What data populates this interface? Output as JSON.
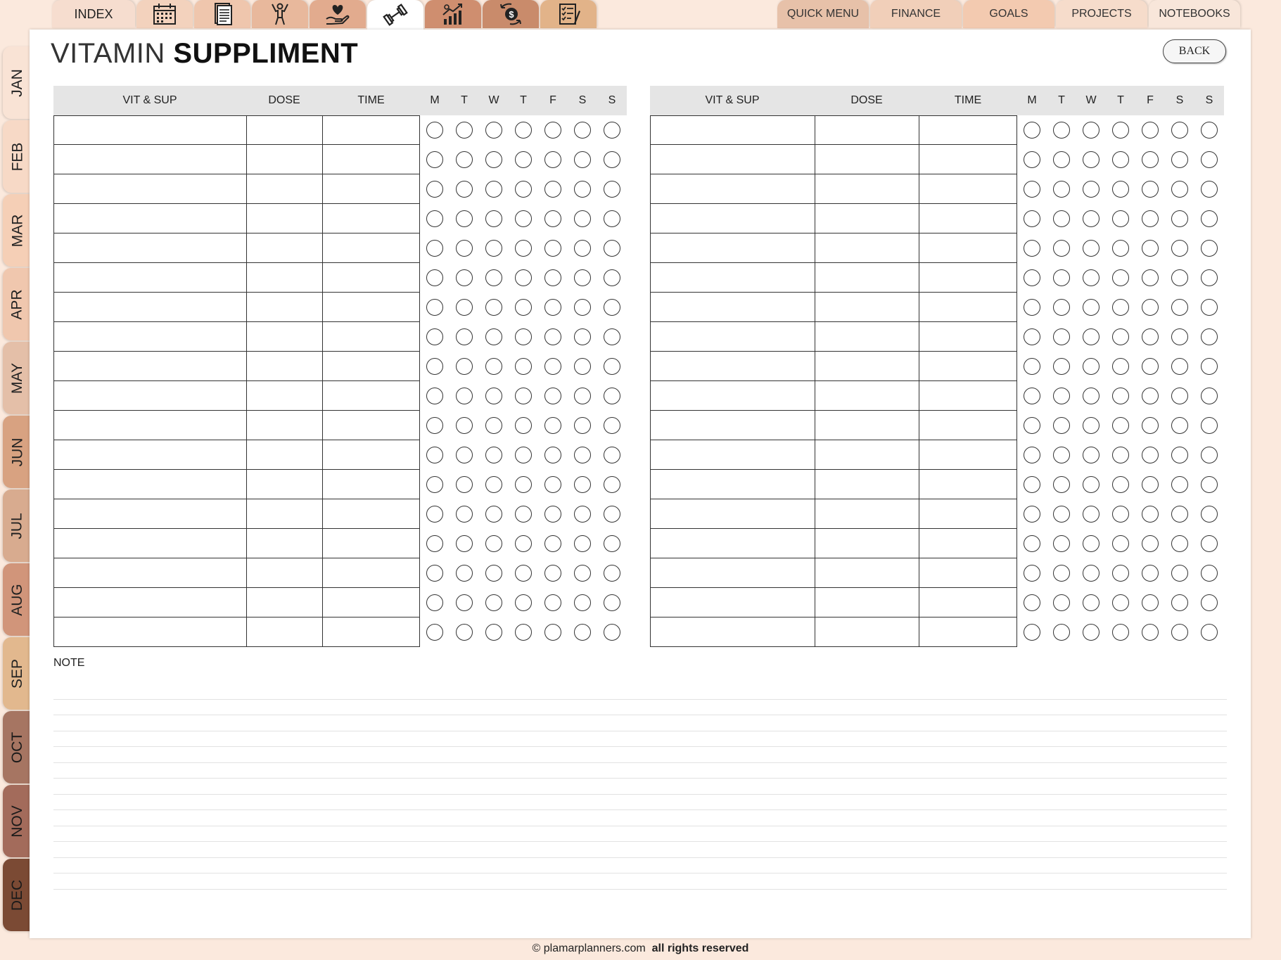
{
  "top_nav": {
    "index_label": "INDEX",
    "icon_tabs": [
      {
        "icon": "calendar-icon",
        "color": "#f3d2bd"
      },
      {
        "icon": "document-icon",
        "color": "#efc6ad"
      },
      {
        "icon": "fitness-person-icon",
        "color": "#e8b89c"
      },
      {
        "icon": "heart-hand-icon",
        "color": "#e2ab8e"
      },
      {
        "icon": "dumbbell-icon",
        "color": "#ffffff",
        "active": true
      },
      {
        "icon": "growth-chart-icon",
        "color": "#cf8e6f"
      },
      {
        "icon": "money-exchange-icon",
        "color": "#c98b6b"
      },
      {
        "icon": "checklist-icon",
        "color": "#e2b389"
      }
    ],
    "index_color": "#f6ddcf"
  },
  "right_nav": [
    {
      "label": "QUICK MENU",
      "color": "#e7c1a9"
    },
    {
      "label": "FINANCE",
      "color": "#f1cfb9"
    },
    {
      "label": "GOALS",
      "color": "#f3cab0"
    },
    {
      "label": "PROJECTS",
      "color": "#f6dccb"
    },
    {
      "label": "NOTEBOOKS",
      "color": "#f8e6da"
    }
  ],
  "months": [
    {
      "label": "JAN",
      "color": "#f9e3d5"
    },
    {
      "label": "FEB",
      "color": "#f7d9c6"
    },
    {
      "label": "MAR",
      "color": "#f5cfb6"
    },
    {
      "label": "APR",
      "color": "#f0c7ae"
    },
    {
      "label": "MAY",
      "color": "#e4bfa8"
    },
    {
      "label": "JUN",
      "color": "#d8a281"
    },
    {
      "label": "JUL",
      "color": "#d8ab8f"
    },
    {
      "label": "AUG",
      "color": "#d1957a"
    },
    {
      "label": "SEP",
      "color": "#e2b88e"
    },
    {
      "label": "OCT",
      "color": "#a67562"
    },
    {
      "label": "NOV",
      "color": "#a36b5b"
    },
    {
      "label": "DEC",
      "color": "#7b4a34"
    }
  ],
  "page": {
    "title_thin": "VITAMIN",
    "title_bold": "SUPPLIMENT",
    "back_label": "BACK",
    "note_label": "NOTE",
    "footer_site": "© plamarplanners.com",
    "footer_rights": "all rights reserved"
  },
  "tracker_headers": {
    "vit": "VIT & SUP",
    "dose": "DOSE",
    "time": "TIME",
    "days": [
      "M",
      "T",
      "W",
      "T",
      "F",
      "S",
      "S"
    ]
  },
  "tracker_rows": 18
}
